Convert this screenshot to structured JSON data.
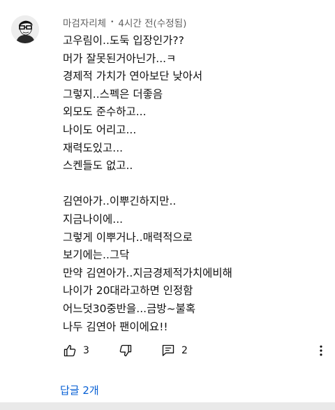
{
  "comment": {
    "author": "마검자리체",
    "separator": "•",
    "time": "4시간 전(수정됨)",
    "lines": [
      "고우림이..도둑 입장인가??",
      "머가 잘못된거아닌가...ㅋ",
      "경제적 가치가 연아보단 낮아서",
      "그렇지..스펙은 더좋음",
      "외모도 준수하고...",
      "나이도 어리고...",
      "재력도있고...",
      "스켄들도 없고..",
      "",
      "김연아가..이뿌긴하지만..",
      "지금나이에...",
      "그렇게 이뿌거나..매력적으로",
      "보기에는..그닥",
      "만약 김연아가..지금경제적가치에비해",
      "나이가 20대라고하면 인정함",
      "어느덧30중반을...금방~불혹",
      "나두 김연아 팬이에요!!"
    ]
  },
  "actions": {
    "like_count": "3",
    "reply_count": "2",
    "icons": [
      "thumbs-up-icon",
      "thumbs-down-icon",
      "comment-icon",
      "more-vert-icon"
    ]
  },
  "replies_link": "답글 2개",
  "colors": {
    "text": "#0f0f0f",
    "meta": "#606060",
    "link": "#065fd4"
  }
}
